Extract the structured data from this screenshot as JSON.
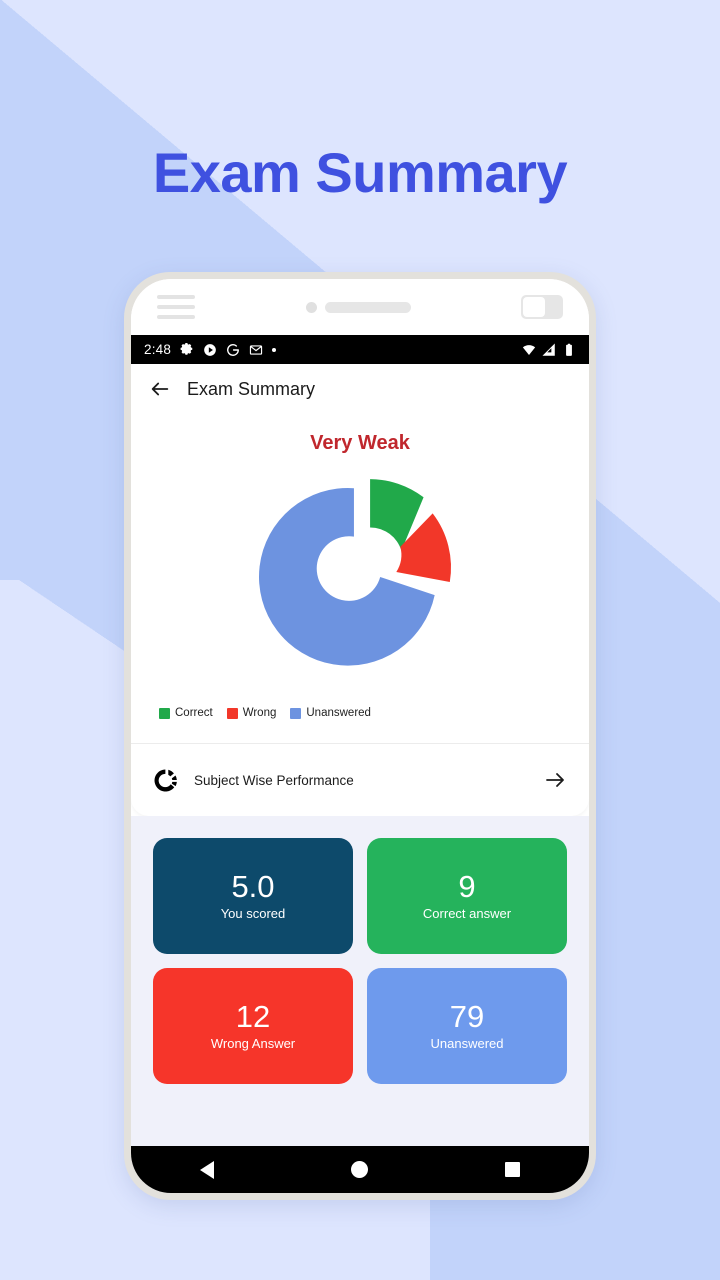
{
  "page": {
    "title": "Exam Summary",
    "title_color": "#3f51e0",
    "background_color": "#c2d3fa",
    "band_color": "#dde5fe"
  },
  "status_bar": {
    "time": "2:48",
    "left_icons": [
      "settings-gear-icon",
      "play-store-icon",
      "google-icon",
      "gmail-icon",
      "more-dot-icon"
    ],
    "right_icons": [
      "wifi-icon",
      "signal-icon",
      "battery-icon"
    ]
  },
  "app_bar": {
    "back_icon": "arrow-left-icon",
    "title": "Exam Summary"
  },
  "summary": {
    "verdict": "Very Weak",
    "verdict_color": "#c0272d"
  },
  "chart_data": {
    "type": "pie",
    "title": "Very Weak",
    "donut": true,
    "categories": [
      "Correct",
      "Wrong",
      "Unanswered"
    ],
    "values": [
      9,
      12,
      79
    ],
    "colors": [
      "#21a94a",
      "#f23729",
      "#6d93e0"
    ],
    "exploded": [
      true,
      true,
      false
    ],
    "legend_position": "bottom-left",
    "total": 100
  },
  "legend": [
    {
      "label": "Correct",
      "color": "#21a94a"
    },
    {
      "label": "Wrong",
      "color": "#f23729"
    },
    {
      "label": "Unanswered",
      "color": "#6d93e0"
    }
  ],
  "subject_wise": {
    "icon": "donut-chart-icon",
    "label": "Subject Wise Performance",
    "arrow_icon": "arrow-right-icon"
  },
  "stats": [
    {
      "value": "5.0",
      "label": "You scored",
      "color": "#0d4a6b"
    },
    {
      "value": "9",
      "label": "Correct answer",
      "color": "#25b35c"
    },
    {
      "value": "12",
      "label": "Wrong Answer",
      "color": "#f6352a"
    },
    {
      "value": "79",
      "label": "Unanswered",
      "color": "#6e9aed"
    }
  ],
  "nav_bar": {
    "back": "nav-back-icon",
    "home": "nav-home-icon",
    "recents": "nav-recents-icon"
  }
}
